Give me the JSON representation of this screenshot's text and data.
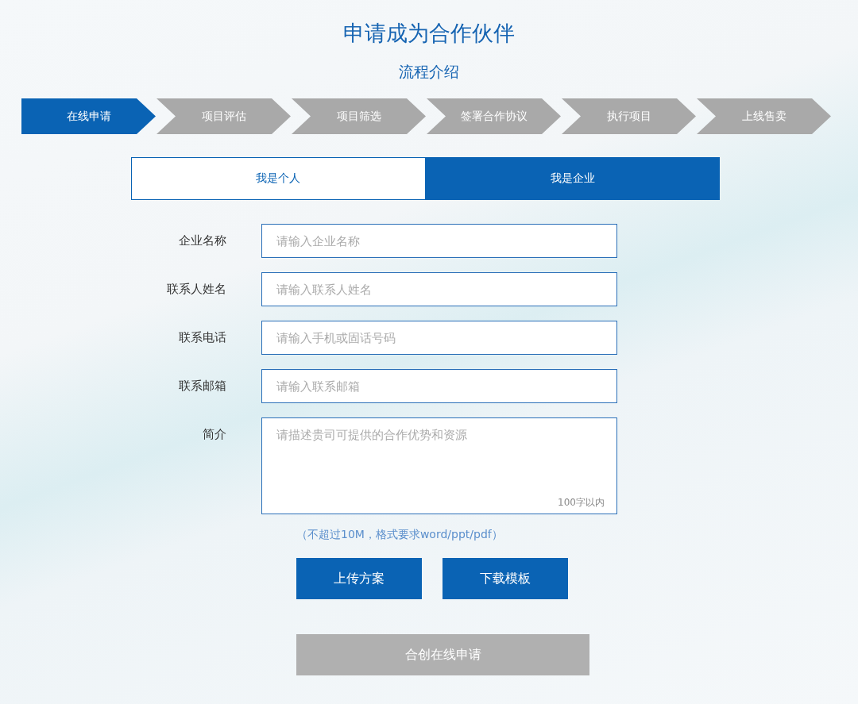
{
  "title": "申请成为合作伙伴",
  "process": {
    "title": "流程介绍",
    "steps": [
      {
        "label": "在线申请",
        "selected": true
      },
      {
        "label": "项目评估",
        "selected": false
      },
      {
        "label": "项目筛选",
        "selected": false
      },
      {
        "label": "签署合作协议",
        "selected": false
      },
      {
        "label": "执行项目",
        "selected": false
      },
      {
        "label": "上线售卖",
        "selected": false
      }
    ]
  },
  "tabs": [
    {
      "label": "我是个人",
      "selected": false
    },
    {
      "label": "我是企业",
      "selected": true
    }
  ],
  "form": {
    "fields": [
      {
        "kind": "input",
        "label": "企业名称",
        "placeholder": "请输入企业名称"
      },
      {
        "kind": "input",
        "label": "联系人姓名",
        "placeholder": "请输入联系人姓名"
      },
      {
        "kind": "input",
        "label": "联系电话",
        "placeholder": "请输入手机或固话号码"
      },
      {
        "kind": "input",
        "label": "联系邮箱",
        "placeholder": "请输入联系邮箱"
      },
      {
        "kind": "textarea",
        "label": "简介",
        "placeholder": "请描述贵司可提供的合作优势和资源",
        "counter": "100字以内"
      }
    ],
    "note": "（不超过10M，格式要求word/ppt/pdf）",
    "buttons": [
      "上传方案",
      "下载模板"
    ],
    "submit": {
      "label": "合创在线申请",
      "disabled": true
    }
  }
}
